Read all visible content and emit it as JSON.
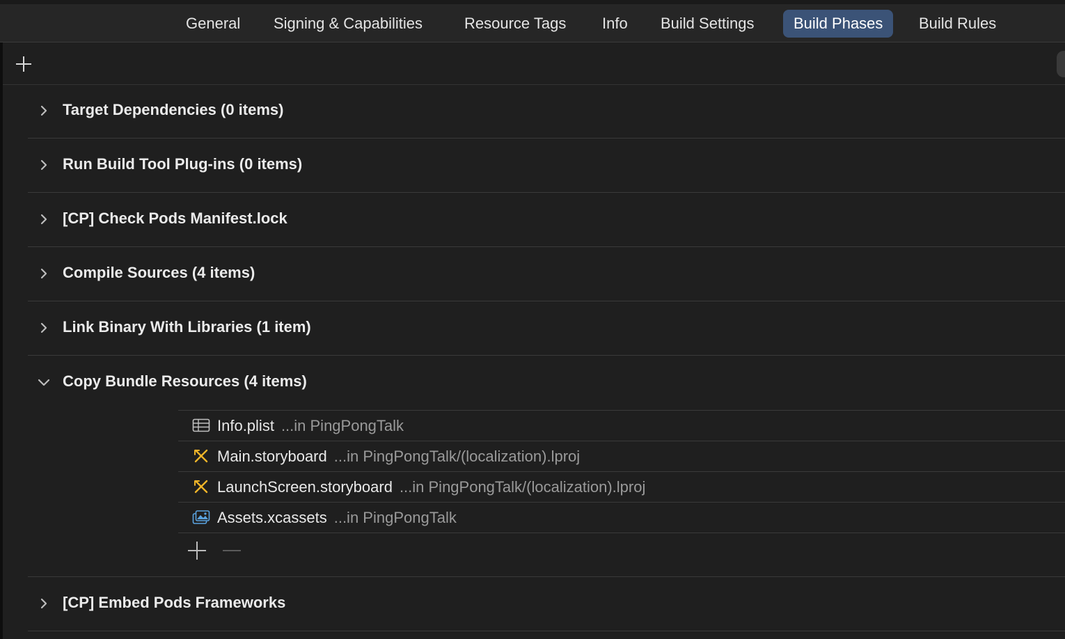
{
  "tabs": [
    {
      "label": "General",
      "active": false
    },
    {
      "label": "Signing & Capabilities",
      "active": false
    },
    {
      "label": "Resource Tags",
      "active": false
    },
    {
      "label": "Info",
      "active": false
    },
    {
      "label": "Build Settings",
      "active": false
    },
    {
      "label": "Build Phases",
      "active": true
    },
    {
      "label": "Build Rules",
      "active": false
    }
  ],
  "phases": [
    {
      "title": "Target Dependencies (0 items)",
      "expanded": false
    },
    {
      "title": "Run Build Tool Plug-ins (0 items)",
      "expanded": false
    },
    {
      "title": "[CP] Check Pods Manifest.lock",
      "expanded": false
    },
    {
      "title": "Compile Sources (4 items)",
      "expanded": false
    },
    {
      "title": "Link Binary With Libraries (1 item)",
      "expanded": false
    },
    {
      "title": "Copy Bundle Resources (4 items)",
      "expanded": true
    },
    {
      "title": "[CP] Embed Pods Frameworks",
      "expanded": false
    }
  ],
  "resources": [
    {
      "name": "Info.plist",
      "location": "...in PingPongTalk",
      "icon": "plist-icon"
    },
    {
      "name": "Main.storyboard",
      "location": "...in PingPongTalk/(localization).lproj",
      "icon": "storyboard-icon"
    },
    {
      "name": "LaunchScreen.storyboard",
      "location": "...in PingPongTalk/(localization).lproj",
      "icon": "storyboard-icon"
    },
    {
      "name": "Assets.xcassets",
      "location": "...in PingPongTalk",
      "icon": "assets-icon"
    }
  ],
  "colors": {
    "background": "#1f1f1f",
    "active_tab": "#3b5377",
    "storyboard_icon": "#f0b429",
    "assets_icon": "#5aa3e0",
    "plist_icon": "#c0c0c0"
  }
}
